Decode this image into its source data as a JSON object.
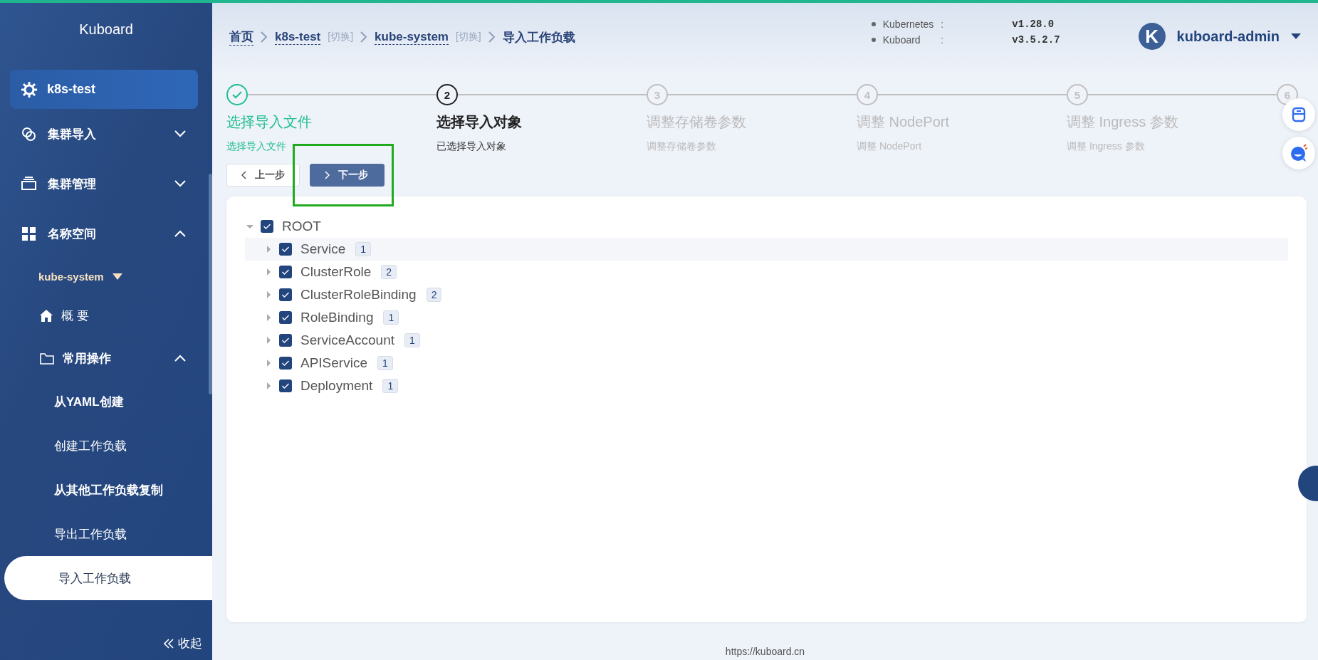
{
  "sidebar": {
    "brand": "Kuboard",
    "cluster": "k8s-test",
    "sections": [
      {
        "label": "集群导入",
        "expanded": false
      },
      {
        "label": "集群管理",
        "expanded": false
      },
      {
        "label": "名称空间",
        "expanded": true
      }
    ],
    "namespace": "kube-system",
    "items": [
      {
        "label": "概 要",
        "kind": "link"
      },
      {
        "label": "常用操作",
        "kind": "group",
        "expanded": true,
        "children": [
          {
            "label": "从YAML创建",
            "bold": true,
            "selected": false
          },
          {
            "label": "创建工作负载",
            "bold": false,
            "selected": false
          },
          {
            "label": "从其他工作负载复制",
            "bold": true,
            "selected": false
          },
          {
            "label": "导出工作负载",
            "bold": false,
            "selected": false
          },
          {
            "label": "导入工作负载",
            "bold": false,
            "selected": true
          }
        ]
      }
    ],
    "collapse": "收起"
  },
  "header": {
    "breadcrumb": [
      {
        "label": "首页",
        "kind": "link"
      },
      {
        "label": "k8s-test",
        "kind": "link",
        "switch": "[切换]"
      },
      {
        "label": "kube-system",
        "kind": "link",
        "switch": "[切换]"
      },
      {
        "label": "导入工作负载",
        "kind": "current"
      }
    ],
    "versions": [
      {
        "name": "Kubernetes",
        "separator": ":",
        "value": "v1.28.0"
      },
      {
        "name": "Kuboard",
        "separator": ":",
        "value": "v3.5.2.7"
      }
    ],
    "user": {
      "avatar": "K",
      "name": "kuboard-admin"
    }
  },
  "steps": [
    {
      "kind": "finish",
      "title": "选择导入文件",
      "subtitle": "选择导入文件"
    },
    {
      "number": "2",
      "kind": "process",
      "title": "选择导入对象",
      "subtitle": "已选择导入对象"
    },
    {
      "number": "3",
      "kind": "wait",
      "title": "调整存储卷参数",
      "subtitle": "调整存储卷参数"
    },
    {
      "number": "4",
      "kind": "wait",
      "title": "调整 NodePort",
      "subtitle": "调整 NodePort"
    },
    {
      "number": "5",
      "kind": "wait",
      "title": "调整 Ingress 参数",
      "subtitle": "调整 Ingress 参数"
    },
    {
      "number": "6",
      "kind": "wait"
    }
  ],
  "buttons": [
    {
      "label": "上一步",
      "kind": "default"
    },
    {
      "label": "下一步",
      "kind": "primary"
    }
  ],
  "highlight_frame": true,
  "tree": {
    "label": "ROOT",
    "checked": true,
    "expanded": true,
    "children": [
      {
        "label": "Service",
        "count": "1",
        "checked": true,
        "expanded": false,
        "highlighted": true
      },
      {
        "label": "ClusterRole",
        "count": "2",
        "checked": true,
        "expanded": false,
        "highlighted": false
      },
      {
        "label": "ClusterRoleBinding",
        "count": "2",
        "checked": true,
        "expanded": false,
        "highlighted": false
      },
      {
        "label": "RoleBinding",
        "count": "1",
        "checked": true,
        "expanded": false,
        "highlighted": false
      },
      {
        "label": "ServiceAccount",
        "count": "1",
        "checked": true,
        "expanded": false,
        "highlighted": false
      },
      {
        "label": "APIService",
        "count": "1",
        "checked": true,
        "expanded": false,
        "highlighted": false
      },
      {
        "label": "Deployment",
        "count": "1",
        "checked": true,
        "expanded": false,
        "highlighted": false
      }
    ]
  },
  "footer": "https://kuboard.cn"
}
